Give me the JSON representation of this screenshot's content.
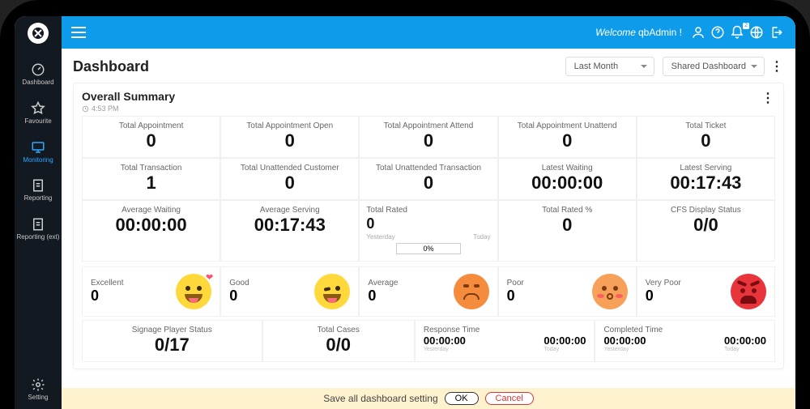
{
  "sidebar": {
    "items": [
      {
        "label": "Dashboard",
        "icon": "gauge"
      },
      {
        "label": "Favourite",
        "icon": "star"
      },
      {
        "label": "Monitoring",
        "icon": "monitor",
        "active": true
      },
      {
        "label": "Reporting",
        "icon": "report"
      },
      {
        "label": "Reporting (ext)",
        "icon": "report"
      },
      {
        "label": "Setting",
        "icon": "gear"
      }
    ]
  },
  "header": {
    "welcome_prefix": "Welcome",
    "username": "qbAdmin !",
    "notif_badge": "2"
  },
  "page": {
    "title": "Dashboard",
    "range_dropdown": "Last Month",
    "view_dropdown": "Shared Dashboard"
  },
  "summary": {
    "title": "Overall Summary",
    "time": "4:53 PM",
    "row1": [
      {
        "label": "Total Appointment",
        "value": "0"
      },
      {
        "label": "Total Appointment Open",
        "value": "0"
      },
      {
        "label": "Total Appointment Attend",
        "value": "0"
      },
      {
        "label": "Total Appointment Unattend",
        "value": "0"
      },
      {
        "label": "Total Ticket",
        "value": "0"
      }
    ],
    "row2": [
      {
        "label": "Total Transaction",
        "value": "1"
      },
      {
        "label": "Total Unattended Customer",
        "value": "0"
      },
      {
        "label": "Total Unattended Transaction",
        "value": "0"
      },
      {
        "label": "Latest Waiting",
        "value": "00:00:00"
      },
      {
        "label": "Latest Serving",
        "value": "00:17:43"
      }
    ],
    "row3": [
      {
        "label": "Average Waiting",
        "value": "00:00:00"
      },
      {
        "label": "Average Serving",
        "value": "00:17:43"
      },
      {
        "label": "Total Rated",
        "value": "0",
        "sub_left": "Yesterday",
        "sub_right": "Today",
        "bar": "0%"
      },
      {
        "label": "Total Rated %",
        "value": "0"
      },
      {
        "label": "CFS Display Status",
        "value": "0/0"
      }
    ],
    "feelings": [
      {
        "label": "Excellent",
        "value": "0",
        "face": "excellent"
      },
      {
        "label": "Good",
        "value": "0",
        "face": "good"
      },
      {
        "label": "Average",
        "value": "0",
        "face": "average"
      },
      {
        "label": "Poor",
        "value": "0",
        "face": "poor"
      },
      {
        "label": "Very Poor",
        "value": "0",
        "face": "vpoor"
      }
    ],
    "row5": {
      "signage": {
        "label": "Signage Player Status",
        "value": "0/17"
      },
      "cases": {
        "label": "Total Cases",
        "value": "0/0"
      },
      "response": {
        "label": "Response Time",
        "left": {
          "v": "00:00:00",
          "s": "Yesterday"
        },
        "right": {
          "v": "00:00:00",
          "s": "Today"
        }
      },
      "completed": {
        "label": "Completed Time",
        "left": {
          "v": "00:00:00",
          "s": "Yesterday"
        },
        "right": {
          "v": "00:00:00",
          "s": "Today"
        }
      }
    }
  },
  "savebar": {
    "text": "Save all dashboard setting",
    "ok": "OK",
    "cancel": "Cancel"
  }
}
